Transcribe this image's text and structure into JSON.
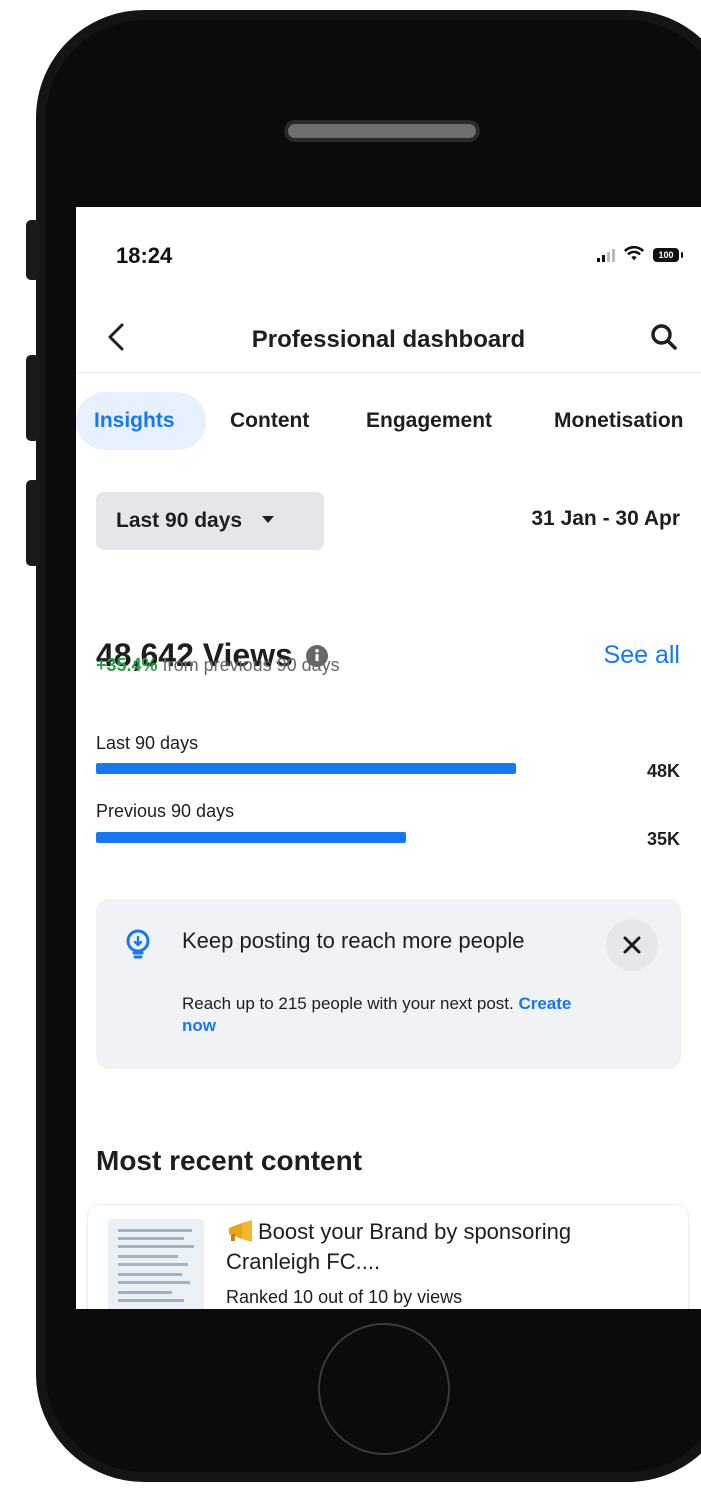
{
  "status_bar": {
    "time": "18:24",
    "battery": "100"
  },
  "nav": {
    "title": "Professional dashboard",
    "back_icon": "chevron-left-icon",
    "search_icon": "search-icon"
  },
  "tabs": [
    {
      "label": "Insights",
      "active": true
    },
    {
      "label": "Content",
      "active": false
    },
    {
      "label": "Engagement",
      "active": false
    },
    {
      "label": "Monetisation",
      "active": false
    }
  ],
  "filter": {
    "range_label": "Last 90 days",
    "dates": "31 Jan - 30 Apr"
  },
  "views": {
    "title": "48,642 Views",
    "see_all": "See all",
    "delta": "+35.4%",
    "delta_suffix": "from previous 90 days",
    "bars": [
      {
        "label": "Last 90 days",
        "value_label": "48K",
        "value": 48642
      },
      {
        "label": "Previous 90 days",
        "value_label": "35K",
        "value": 35929
      }
    ]
  },
  "tip": {
    "title": "Keep posting to reach more people",
    "body": "Reach up to 215 people with your next post.",
    "link": "Create now"
  },
  "recent": {
    "section_title": "Most recent content",
    "items": [
      {
        "title": "Boost your Brand by sponsoring Cranleigh FC....",
        "rank": "Ranked 10 out of 10 by views"
      }
    ]
  },
  "colors": {
    "accent": "#1877f2",
    "positive": "#2aa34a",
    "card_bg": "#f0f2f5",
    "text": "#1c1e21"
  }
}
